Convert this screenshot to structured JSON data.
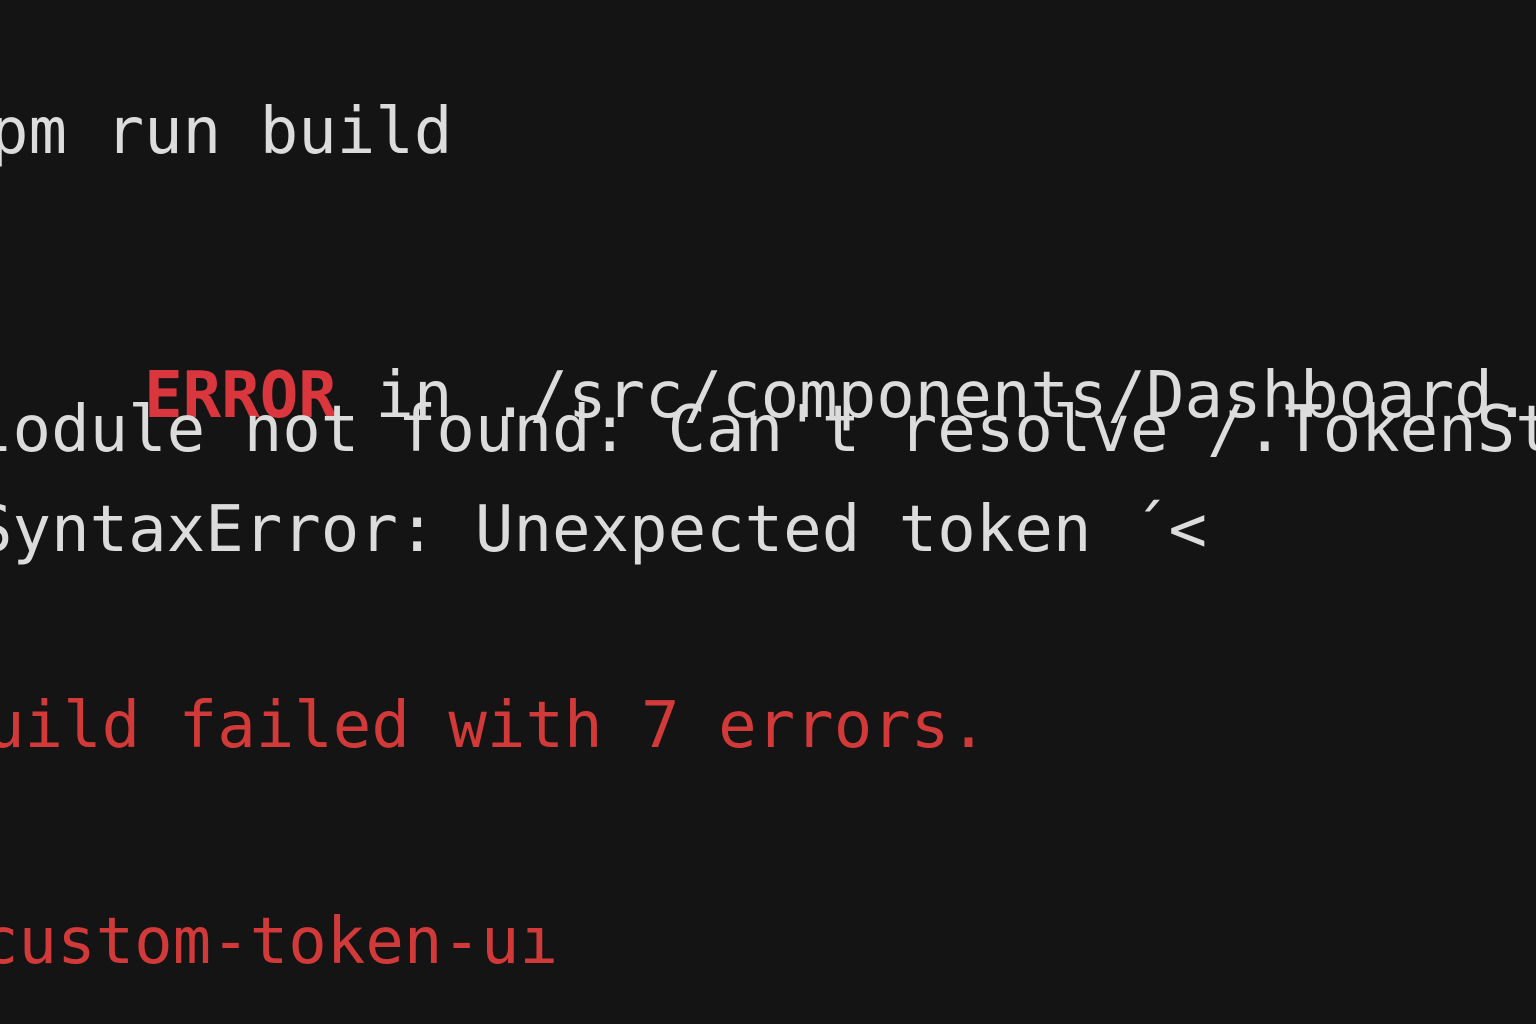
{
  "terminal": {
    "command": "pm run build",
    "error_label": "ERROR",
    "error_location": " in ./src/components/Dashboard.js",
    "module_error": "lodule not found: Can't resolve /.TokenStats'",
    "syntax_error": "SyntaxError: Unexpected token ´<",
    "build_summary": "uild failed with 7 errors.",
    "project_name": "custom-token-uı"
  },
  "colors": {
    "background": "#141414",
    "text": "#dcdcdc",
    "error": "#d23a3a"
  }
}
